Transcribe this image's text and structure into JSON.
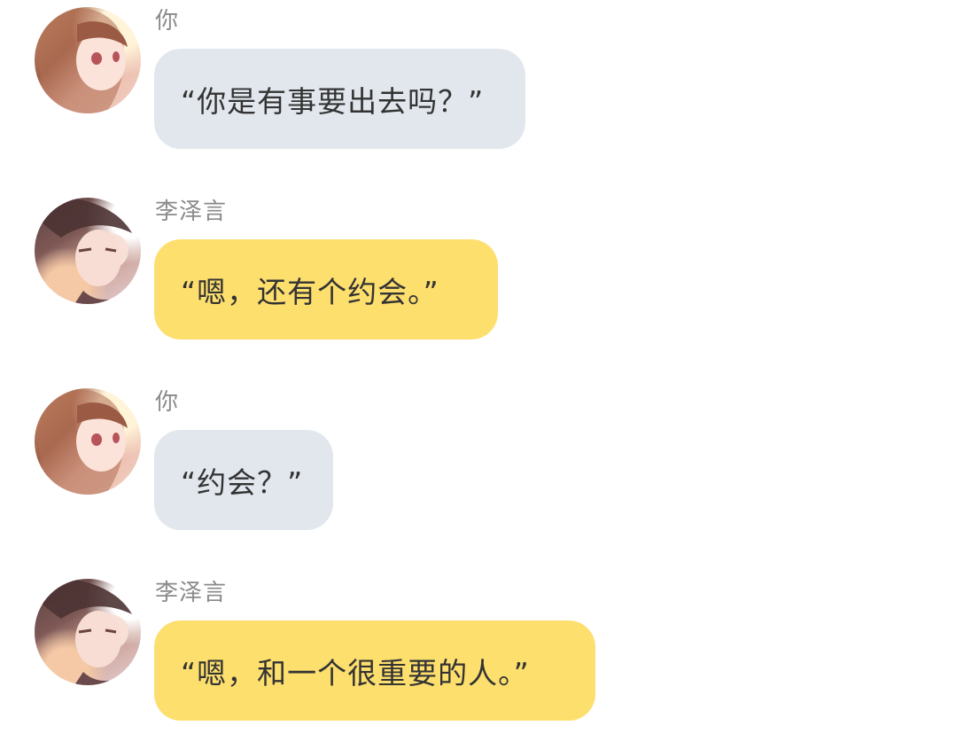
{
  "colors": {
    "self_bubble": "#e1e7ed",
    "other_bubble": "#fddf6e",
    "name_text": "#8a8a8a",
    "message_text": "#333333"
  },
  "messages": [
    {
      "speaker": "你",
      "avatar_icon": "girl-avatar-icon",
      "text": "“你是有事要出去吗？”"
    },
    {
      "speaker": "李泽言",
      "avatar_icon": "boy-avatar-icon",
      "text": "“嗯，还有个约会。”"
    },
    {
      "speaker": "你",
      "avatar_icon": "girl-avatar-icon",
      "text": "“约会？”"
    },
    {
      "speaker": "李泽言",
      "avatar_icon": "boy-avatar-icon",
      "text": "“嗯，和一个很重要的人。”"
    }
  ]
}
